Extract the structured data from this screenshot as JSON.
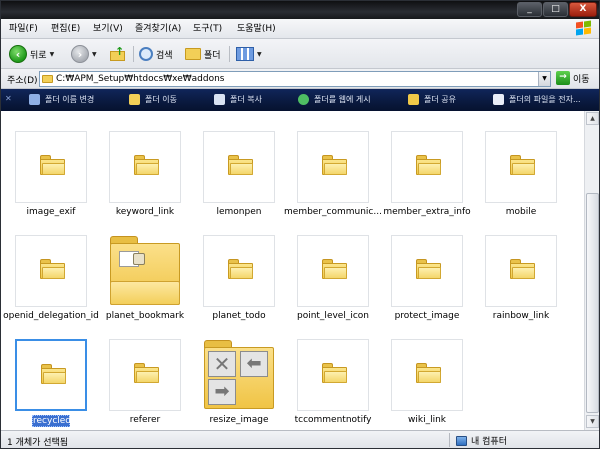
{
  "titlebar": {
    "minimize": "_",
    "maximize": "□",
    "close": "X"
  },
  "menu": [
    "파일(F)",
    "편집(E)",
    "보기(V)",
    "즐겨찾기(A)",
    "도구(T)",
    "도움말(H)"
  ],
  "toolbar": {
    "back": "뒤로",
    "search": "검색",
    "folders": "폴더"
  },
  "address": {
    "label": "주소(D)",
    "value": "C:₩APM_Setup₩htdocs₩xe₩addons",
    "go": "이동"
  },
  "tasks": [
    "폴더 이름 변경",
    "폴더 이동",
    "폴더 복사",
    "폴더를 웹에 게시",
    "폴더 공유",
    "폴더의 파일을 전자..."
  ],
  "items": [
    {
      "name": "image_exif"
    },
    {
      "name": "keyword_link"
    },
    {
      "name": "lemonpen"
    },
    {
      "name": "member_communic..."
    },
    {
      "name": "member_extra_info"
    },
    {
      "name": "mobile"
    },
    {
      "name": "openid_delegation_id"
    },
    {
      "name": "planet_bookmark"
    },
    {
      "name": "planet_todo"
    },
    {
      "name": "point_level_icon"
    },
    {
      "name": "protect_image"
    },
    {
      "name": "rainbow_link"
    },
    {
      "name": "recycled",
      "selected": true
    },
    {
      "name": "referer"
    },
    {
      "name": "resize_image"
    },
    {
      "name": "tccommentnotify"
    },
    {
      "name": "wiki_link"
    }
  ],
  "status": {
    "left": "1 개체가 선택됨",
    "right": "내 컴퓨터"
  },
  "colors": {
    "selection": "#3a6fd0",
    "taskbar": "#0a1a40",
    "folder": "#f0c948"
  }
}
